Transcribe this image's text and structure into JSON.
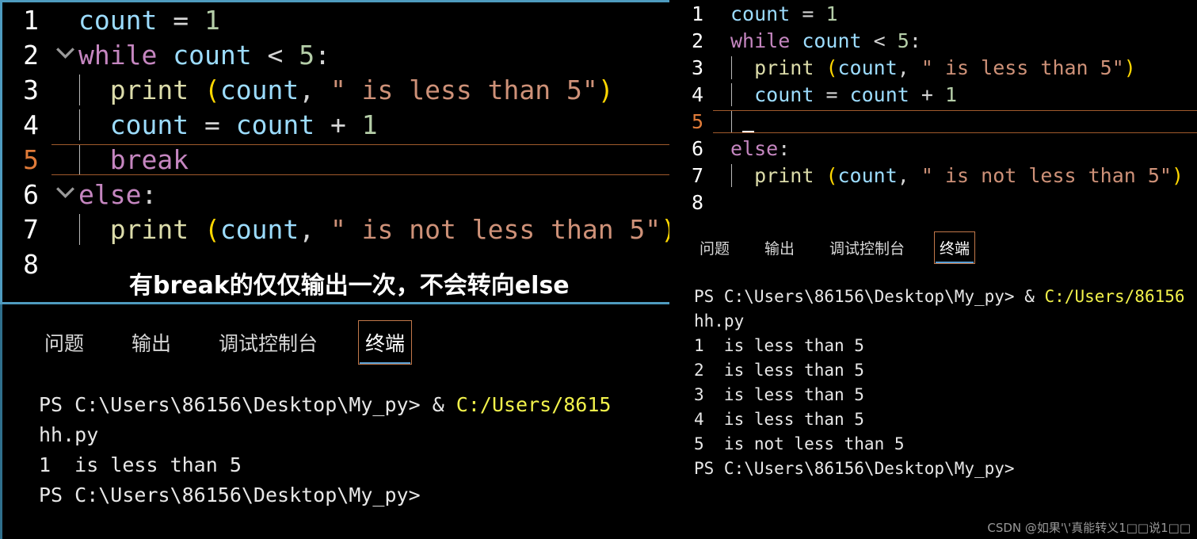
{
  "left_panel": {
    "editor": {
      "lines": [
        {
          "num": "1",
          "fold": "",
          "indent": 0,
          "active": false,
          "tokens": [
            {
              "t": "count",
              "c": "var"
            },
            {
              "t": " ",
              "c": "plain"
            },
            {
              "t": "=",
              "c": "op"
            },
            {
              "t": " ",
              "c": "plain"
            },
            {
              "t": "1",
              "c": "num"
            }
          ]
        },
        {
          "num": "2",
          "fold": "chevron-down",
          "indent": 0,
          "active": false,
          "tokens": [
            {
              "t": "while",
              "c": "kw"
            },
            {
              "t": " ",
              "c": "plain"
            },
            {
              "t": "count",
              "c": "var"
            },
            {
              "t": " ",
              "c": "plain"
            },
            {
              "t": "<",
              "c": "op"
            },
            {
              "t": " ",
              "c": "plain"
            },
            {
              "t": "5",
              "c": "num"
            },
            {
              "t": ":",
              "c": "plain"
            }
          ]
        },
        {
          "num": "3",
          "fold": "",
          "indent": 1,
          "active": false,
          "tokens": [
            {
              "t": "  ",
              "c": "plain"
            },
            {
              "t": "print",
              "c": "fn"
            },
            {
              "t": " ",
              "c": "plain"
            },
            {
              "t": "(",
              "c": "paren"
            },
            {
              "t": "count",
              "c": "var"
            },
            {
              "t": ",",
              "c": "plain"
            },
            {
              "t": " ",
              "c": "plain"
            },
            {
              "t": "\" is less than 5\"",
              "c": "str"
            },
            {
              "t": ")",
              "c": "paren"
            }
          ]
        },
        {
          "num": "4",
          "fold": "",
          "indent": 1,
          "active": false,
          "tokens": [
            {
              "t": "  ",
              "c": "plain"
            },
            {
              "t": "count",
              "c": "var"
            },
            {
              "t": " ",
              "c": "plain"
            },
            {
              "t": "=",
              "c": "op"
            },
            {
              "t": " ",
              "c": "plain"
            },
            {
              "t": "count",
              "c": "var"
            },
            {
              "t": " ",
              "c": "plain"
            },
            {
              "t": "+",
              "c": "op"
            },
            {
              "t": " ",
              "c": "plain"
            },
            {
              "t": "1",
              "c": "num"
            }
          ]
        },
        {
          "num": "5",
          "fold": "",
          "indent": 1,
          "active": true,
          "tokens": [
            {
              "t": "  ",
              "c": "plain"
            },
            {
              "t": "break",
              "c": "kw"
            }
          ]
        },
        {
          "num": "6",
          "fold": "chevron-down",
          "indent": 0,
          "active": false,
          "tokens": [
            {
              "t": "else",
              "c": "kw"
            },
            {
              "t": ":",
              "c": "plain"
            }
          ]
        },
        {
          "num": "7",
          "fold": "",
          "indent": 1,
          "active": false,
          "tokens": [
            {
              "t": "  ",
              "c": "plain"
            },
            {
              "t": "print",
              "c": "fn"
            },
            {
              "t": " ",
              "c": "plain"
            },
            {
              "t": "(",
              "c": "paren"
            },
            {
              "t": "count",
              "c": "var"
            },
            {
              "t": ",",
              "c": "plain"
            },
            {
              "t": " ",
              "c": "plain"
            },
            {
              "t": "\" is not less than 5\"",
              "c": "str"
            },
            {
              "t": ")",
              "c": "paren"
            }
          ]
        },
        {
          "num": "8",
          "fold": "",
          "indent": 0,
          "active": false,
          "tokens": []
        }
      ],
      "annotation": "有break的仅仅输出一次，不会转向else"
    },
    "panel": {
      "tabs": [
        {
          "label": "问题",
          "active": false
        },
        {
          "label": "输出",
          "active": false
        },
        {
          "label": "调试控制台",
          "active": false
        },
        {
          "label": "终端",
          "active": true
        }
      ],
      "terminal_lines": [
        {
          "parts": [
            {
              "t": "PS C:\\Users\\86156\\Desktop\\My_py> & ",
              "c": "plain"
            },
            {
              "t": "C:/Users/8615",
              "c": "path"
            }
          ]
        },
        {
          "parts": [
            {
              "t": "hh.py",
              "c": "plain"
            }
          ]
        },
        {
          "parts": [
            {
              "t": "1  is less than 5",
              "c": "plain"
            }
          ]
        },
        {
          "parts": [
            {
              "t": "PS C:\\Users\\86156\\Desktop\\My_py>",
              "c": "plain"
            }
          ]
        }
      ]
    }
  },
  "right_panel": {
    "editor": {
      "lines": [
        {
          "num": "1",
          "fold": "",
          "indent": 0,
          "active": false,
          "tokens": [
            {
              "t": "count",
              "c": "var"
            },
            {
              "t": " ",
              "c": "plain"
            },
            {
              "t": "=",
              "c": "op"
            },
            {
              "t": " ",
              "c": "plain"
            },
            {
              "t": "1",
              "c": "num"
            }
          ]
        },
        {
          "num": "2",
          "fold": "",
          "indent": 0,
          "active": false,
          "tokens": [
            {
              "t": "while",
              "c": "kw"
            },
            {
              "t": " ",
              "c": "plain"
            },
            {
              "t": "count",
              "c": "var"
            },
            {
              "t": " ",
              "c": "plain"
            },
            {
              "t": "<",
              "c": "op"
            },
            {
              "t": " ",
              "c": "plain"
            },
            {
              "t": "5",
              "c": "num"
            },
            {
              "t": ":",
              "c": "plain"
            }
          ]
        },
        {
          "num": "3",
          "fold": "",
          "indent": 1,
          "active": false,
          "tokens": [
            {
              "t": "  ",
              "c": "plain"
            },
            {
              "t": "print",
              "c": "fn"
            },
            {
              "t": " ",
              "c": "plain"
            },
            {
              "t": "(",
              "c": "paren"
            },
            {
              "t": "count",
              "c": "var"
            },
            {
              "t": ",",
              "c": "plain"
            },
            {
              "t": " ",
              "c": "plain"
            },
            {
              "t": "\" is less than 5\"",
              "c": "str"
            },
            {
              "t": ")",
              "c": "paren"
            }
          ]
        },
        {
          "num": "4",
          "fold": "",
          "indent": 1,
          "active": false,
          "tokens": [
            {
              "t": "  ",
              "c": "plain"
            },
            {
              "t": "count",
              "c": "var"
            },
            {
              "t": " ",
              "c": "plain"
            },
            {
              "t": "=",
              "c": "op"
            },
            {
              "t": " ",
              "c": "plain"
            },
            {
              "t": "count",
              "c": "var"
            },
            {
              "t": " ",
              "c": "plain"
            },
            {
              "t": "+",
              "c": "op"
            },
            {
              "t": " ",
              "c": "plain"
            },
            {
              "t": "1",
              "c": "num"
            }
          ]
        },
        {
          "num": "5",
          "fold": "",
          "indent": 1,
          "active": true,
          "cursor": true,
          "tokens": []
        },
        {
          "num": "6",
          "fold": "",
          "indent": 0,
          "active": false,
          "tokens": [
            {
              "t": "else",
              "c": "kw"
            },
            {
              "t": ":",
              "c": "plain"
            }
          ]
        },
        {
          "num": "7",
          "fold": "",
          "indent": 1,
          "active": false,
          "tokens": [
            {
              "t": "  ",
              "c": "plain"
            },
            {
              "t": "print",
              "c": "fn"
            },
            {
              "t": " ",
              "c": "plain"
            },
            {
              "t": "(",
              "c": "paren"
            },
            {
              "t": "count",
              "c": "var"
            },
            {
              "t": ",",
              "c": "plain"
            },
            {
              "t": " ",
              "c": "plain"
            },
            {
              "t": "\" is not less than 5\"",
              "c": "str"
            },
            {
              "t": ")",
              "c": "paren"
            }
          ]
        },
        {
          "num": "8",
          "fold": "",
          "indent": 0,
          "active": false,
          "tokens": []
        }
      ]
    },
    "panel": {
      "tabs": [
        {
          "label": "问题",
          "active": false
        },
        {
          "label": "输出",
          "active": false
        },
        {
          "label": "调试控制台",
          "active": false
        },
        {
          "label": "终端",
          "active": true
        }
      ],
      "terminal_lines": [
        {
          "parts": [
            {
              "t": "PS C:\\Users\\86156\\Desktop\\My_py> & ",
              "c": "plain"
            },
            {
              "t": "C:/Users/86156",
              "c": "path"
            }
          ]
        },
        {
          "parts": [
            {
              "t": "hh.py",
              "c": "plain"
            }
          ]
        },
        {
          "parts": [
            {
              "t": "1  is less than 5",
              "c": "plain"
            }
          ]
        },
        {
          "parts": [
            {
              "t": "2  is less than 5",
              "c": "plain"
            }
          ]
        },
        {
          "parts": [
            {
              "t": "3  is less than 5",
              "c": "plain"
            }
          ]
        },
        {
          "parts": [
            {
              "t": "4  is less than 5",
              "c": "plain"
            }
          ]
        },
        {
          "parts": [
            {
              "t": "5  is not less than 5",
              "c": "plain"
            }
          ]
        },
        {
          "parts": [
            {
              "t": "PS C:\\Users\\86156\\Desktop\\My_py>",
              "c": "plain"
            }
          ]
        }
      ]
    }
  },
  "watermark": "CSDN @如果'\\'真能转义1□□说1□□",
  "colors": {
    "background": "#000000",
    "overlay_border": "#4e9bbf",
    "active_line_border": "#a05a2c",
    "tab_focus_border": "#c2784a",
    "tab_underline": "#5a9fd4",
    "terminal_path": "#f2f24b",
    "keyword": "#C586C0",
    "variable": "#9CDCFE",
    "function": "#DCDCAA",
    "string": "#CE9178",
    "number": "#B5CEA8",
    "paren": "#FFD700",
    "line_number": "#ffffff",
    "line_number_active": "#e07b39"
  }
}
